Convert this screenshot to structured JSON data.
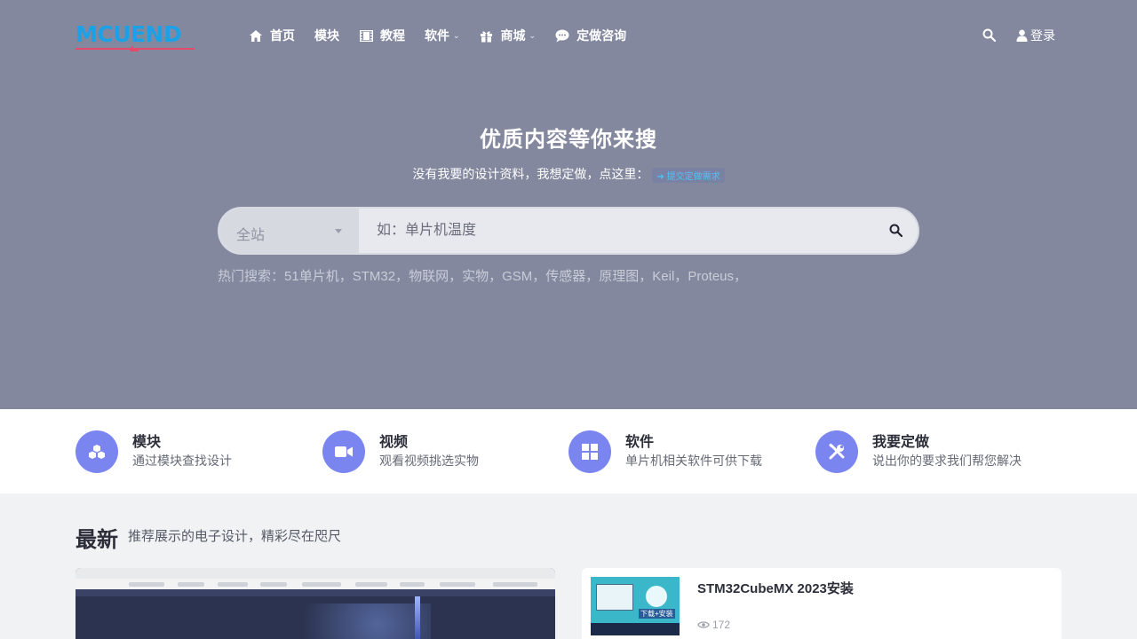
{
  "nav": {
    "logo_text": "MCUEND",
    "items": [
      {
        "label": "首页"
      },
      {
        "label": "模块"
      },
      {
        "label": "教程"
      },
      {
        "label": "软件"
      },
      {
        "label": "商城"
      },
      {
        "label": "定做咨询"
      }
    ],
    "login_label": "登录"
  },
  "hero": {
    "title": "优质内容等你来搜",
    "subtitle": "没有我要的设计资料，我想定做，点这里：",
    "pill_label": "提交定做需求"
  },
  "search": {
    "scope_label": "全站",
    "placeholder": "如：单片机温度"
  },
  "hot_search": {
    "label": "热门搜索：",
    "terms": [
      "51单片机，",
      "STM32，",
      "物联网，",
      "实物，",
      "GSM，",
      "传感器，",
      "原理图，",
      "Keil，",
      "Proteus，"
    ]
  },
  "features": [
    {
      "title": "模块",
      "desc": "通过模块查找设计",
      "icon": "cubes-icon"
    },
    {
      "title": "视频",
      "desc": "观看视频挑选实物",
      "icon": "video-camera-icon"
    },
    {
      "title": "软件",
      "desc": "单片机相关软件可供下载",
      "icon": "windows-icon"
    },
    {
      "title": "我要定做",
      "desc": "说出你的要求我们帮您解决",
      "icon": "tools-icon"
    }
  ],
  "latest": {
    "title": "最新",
    "subtitle": "推荐展示的电子设计，精彩尽在咫尺"
  },
  "side_post": {
    "title": "STM32CubeMX 2023安装",
    "views": "172",
    "thumb_tag": "下载+安装"
  },
  "colors": {
    "hero_bg": "#84889f",
    "accent": "#7b85f0",
    "logo": "#1da1e6"
  }
}
